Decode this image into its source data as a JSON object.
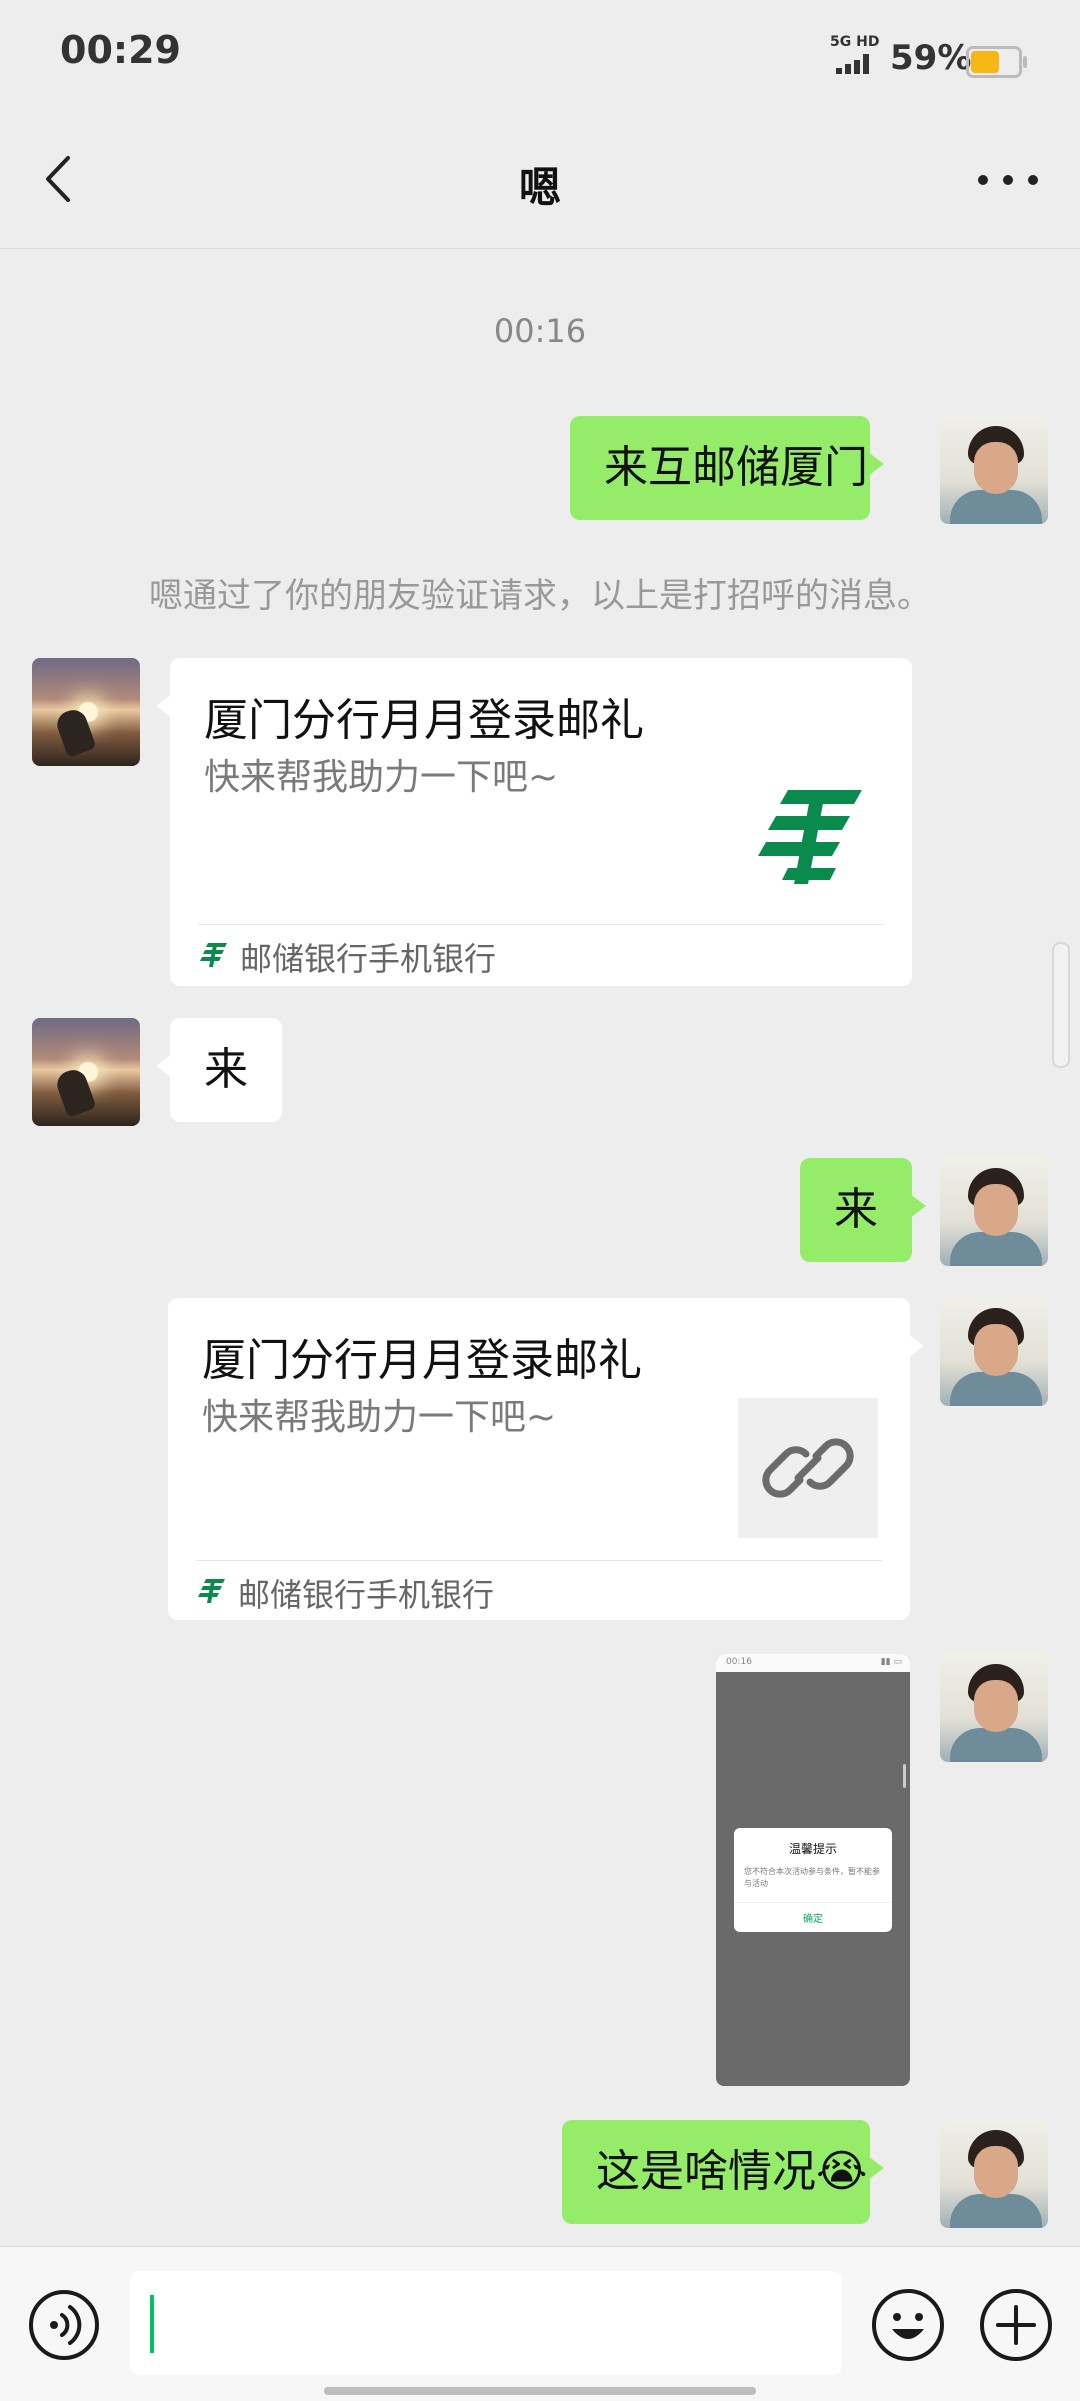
{
  "status_bar": {
    "time": "00:29",
    "network": "5G HD",
    "battery_percent": "59%",
    "battery_level": 0.59,
    "battery_color": "#f6b614"
  },
  "nav": {
    "title": "嗯",
    "back_icon": "chevron-left-icon",
    "more_icon": "ellipsis-icon"
  },
  "chat": {
    "timestamp": "00:16",
    "system_note": "嗯通过了你的朋友验证请求，以上是打招呼的消息。",
    "messages": [
      {
        "type": "text",
        "side": "right",
        "text": "来互邮储厦门"
      },
      {
        "type": "card",
        "side": "left",
        "title": "厦门分行月月登录邮礼",
        "desc": "快来帮我助力一下吧~",
        "source": "邮储银行手机银行",
        "thumb": "postal-logo"
      },
      {
        "type": "text",
        "side": "left",
        "text": "来"
      },
      {
        "type": "text",
        "side": "right",
        "text": "来"
      },
      {
        "type": "card",
        "side": "right",
        "title": "厦门分行月月登录邮礼",
        "desc": "快来帮我助力一下吧~",
        "source": "邮储银行手机银行",
        "thumb": "link-icon"
      },
      {
        "type": "image",
        "side": "right",
        "screenshot": {
          "time": "00:16",
          "dialog_title": "温馨提示",
          "dialog_text": "您不符合本次活动参与条件，暂不能参与活动",
          "dialog_button": "确定"
        }
      },
      {
        "type": "text",
        "side": "right",
        "text": "这是啥情况😭"
      }
    ]
  },
  "input_bar": {
    "voice_icon": "voice-icon",
    "emoji_icon": "emoji-icon",
    "plus_icon": "plus-icon",
    "accent_color": "#07c160"
  },
  "colors": {
    "bubble_green": "#95ec69",
    "background": "#ededed",
    "postal_green": "#0b8a4e"
  }
}
